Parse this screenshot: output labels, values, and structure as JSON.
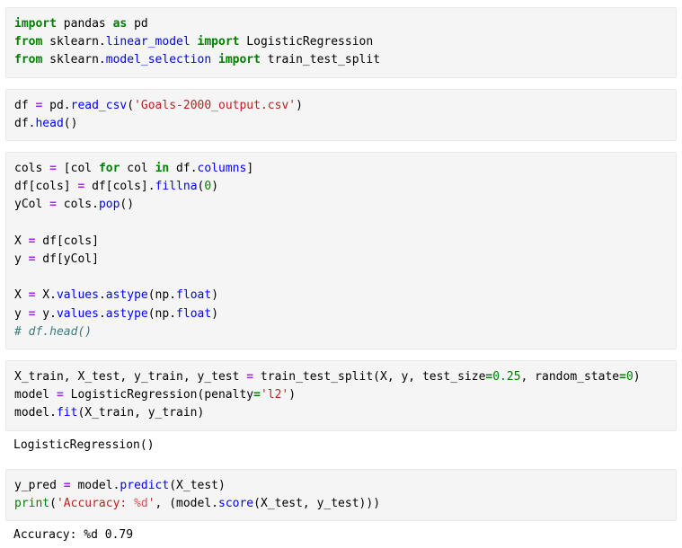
{
  "document": {
    "type": "jupyter-notebook-export",
    "colors": {
      "background": "#ffffff",
      "cell_background": "#f5f5f5",
      "cell_border": "#e8e8e8",
      "keyword": "#008000",
      "builtin": "#008000",
      "module": "#0000ff",
      "function": "#0000ff",
      "string": "#ba2121",
      "string_format": "#d85050",
      "operator": "#aa22ff",
      "number": "#008000",
      "comment": "#3d7b7b",
      "text": "#000000"
    }
  },
  "cells": [
    {
      "name": "imports-cell",
      "type": "code",
      "lines": [
        "import pandas as pd",
        "from sklearn.linear_model import LogisticRegression",
        "from sklearn.model_selection import train_test_split"
      ]
    },
    {
      "name": "load-data-cell",
      "type": "code",
      "lines": [
        "df = pd.read_csv('Goals-2000_output.csv')",
        "df.head()"
      ]
    },
    {
      "name": "prepare-features-cell",
      "type": "code",
      "lines": [
        "cols = [col for col in df.columns]",
        "df[cols] = df[cols].fillna(0)",
        "yCol = cols.pop()",
        "",
        "X = df[cols]",
        "y = df[yCol]",
        "",
        "X = X.values.astype(np.float)",
        "y = y.values.astype(np.float)",
        "# df.head()"
      ]
    },
    {
      "name": "train-model-cell",
      "type": "code",
      "lines": [
        "X_train, X_test, y_train, y_test = train_test_split(X, y, test_size=0.25, random_state=0)",
        "model = LogisticRegression(penalty='l2')",
        "model.fit(X_train, y_train)"
      ]
    },
    {
      "name": "model-output",
      "type": "output",
      "lines": [
        "LogisticRegression()"
      ]
    },
    {
      "name": "predict-score-cell",
      "type": "code",
      "lines": [
        "y_pred = model.predict(X_test)",
        "print('Accuracy: %d', (model.score(X_test, y_test)))"
      ]
    },
    {
      "name": "accuracy-output",
      "type": "output",
      "lines": [
        "Accuracy: %d 0.79"
      ]
    }
  ],
  "tokens": {
    "c1_l1": [
      [
        "import",
        "t-k"
      ],
      [
        " pandas ",
        "t-n"
      ],
      [
        "as",
        "t-k"
      ],
      [
        " pd",
        "t-n"
      ]
    ],
    "c1_l2": [
      [
        "from",
        "t-k"
      ],
      [
        " sklearn.",
        "t-n"
      ],
      [
        "linear_model",
        "t-nn"
      ],
      [
        " ",
        "t-n"
      ],
      [
        "import",
        "t-k"
      ],
      [
        " LogisticRegression",
        "t-n"
      ]
    ],
    "c1_l3": [
      [
        "from",
        "t-k"
      ],
      [
        " sklearn.",
        "t-n"
      ],
      [
        "model_selection",
        "t-nn"
      ],
      [
        " ",
        "t-n"
      ],
      [
        "import",
        "t-k"
      ],
      [
        " train_test_split",
        "t-n"
      ]
    ],
    "c2_l1": [
      [
        "df ",
        "t-n"
      ],
      [
        "=",
        "t-o"
      ],
      [
        " pd.",
        "t-n"
      ],
      [
        "read_csv",
        "t-nf"
      ],
      [
        "(",
        "t-n"
      ],
      [
        "'Goals-2000_output.csv'",
        "t-s"
      ],
      [
        ")",
        "t-n"
      ]
    ],
    "c2_l2": [
      [
        "df.",
        "t-n"
      ],
      [
        "head",
        "t-nf"
      ],
      [
        "()",
        "t-n"
      ]
    ],
    "c3_l1": [
      [
        "cols ",
        "t-n"
      ],
      [
        "=",
        "t-o"
      ],
      [
        " [col ",
        "t-n"
      ],
      [
        "for",
        "t-k"
      ],
      [
        " col ",
        "t-n"
      ],
      [
        "in",
        "t-k"
      ],
      [
        " df.",
        "t-n"
      ],
      [
        "columns",
        "t-nn"
      ],
      [
        "]",
        "t-n"
      ]
    ],
    "c3_l2": [
      [
        "df[cols] ",
        "t-n"
      ],
      [
        "=",
        "t-o"
      ],
      [
        " df[cols].",
        "t-n"
      ],
      [
        "fillna",
        "t-nf"
      ],
      [
        "(",
        "t-n"
      ],
      [
        "0",
        "t-m"
      ],
      [
        ")",
        "t-n"
      ]
    ],
    "c3_l3": [
      [
        "yCol ",
        "t-n"
      ],
      [
        "=",
        "t-o"
      ],
      [
        " cols.",
        "t-n"
      ],
      [
        "pop",
        "t-nf"
      ],
      [
        "()",
        "t-n"
      ]
    ],
    "c3_l5": [
      [
        "X ",
        "t-n"
      ],
      [
        "=",
        "t-o"
      ],
      [
        " df[cols]",
        "t-n"
      ]
    ],
    "c3_l6": [
      [
        "y ",
        "t-n"
      ],
      [
        "=",
        "t-o"
      ],
      [
        " df[yCol]",
        "t-n"
      ]
    ],
    "c3_l8": [
      [
        "X ",
        "t-n"
      ],
      [
        "=",
        "t-o"
      ],
      [
        " X.",
        "t-n"
      ],
      [
        "values",
        "t-nn"
      ],
      [
        ".",
        "t-n"
      ],
      [
        "astype",
        "t-nf"
      ],
      [
        "(np.",
        "t-n"
      ],
      [
        "float",
        "t-nn"
      ],
      [
        ")",
        "t-n"
      ]
    ],
    "c3_l9": [
      [
        "y ",
        "t-n"
      ],
      [
        "=",
        "t-o"
      ],
      [
        " y.",
        "t-n"
      ],
      [
        "values",
        "t-nn"
      ],
      [
        ".",
        "t-n"
      ],
      [
        "astype",
        "t-nf"
      ],
      [
        "(np.",
        "t-n"
      ],
      [
        "float",
        "t-nn"
      ],
      [
        ")",
        "t-n"
      ]
    ],
    "c3_l10": [
      [
        "# df.head()",
        "t-c"
      ]
    ],
    "c4_l1": [
      [
        "X_train, X_test, y_train, y_test ",
        "t-n"
      ],
      [
        "=",
        "t-o"
      ],
      [
        " train_test_split(X, y, test_size",
        "t-n"
      ],
      [
        "=",
        "t-ow"
      ],
      [
        "0.25",
        "t-m"
      ],
      [
        ", random_state",
        "t-n"
      ],
      [
        "=",
        "t-ow"
      ],
      [
        "0",
        "t-m"
      ],
      [
        ")",
        "t-n"
      ]
    ],
    "c4_l2": [
      [
        "model ",
        "t-n"
      ],
      [
        "=",
        "t-o"
      ],
      [
        " LogisticRegression(penalty",
        "t-n"
      ],
      [
        "=",
        "t-ow"
      ],
      [
        "'l2'",
        "t-s"
      ],
      [
        ")",
        "t-n"
      ]
    ],
    "c4_l3": [
      [
        "model.",
        "t-n"
      ],
      [
        "fit",
        "t-nf"
      ],
      [
        "(X_train, y_train)",
        "t-n"
      ]
    ],
    "c6_l1": [
      [
        "y_pred ",
        "t-n"
      ],
      [
        "=",
        "t-o"
      ],
      [
        " model.",
        "t-n"
      ],
      [
        "predict",
        "t-nf"
      ],
      [
        "(X_test)",
        "t-n"
      ]
    ],
    "c6_l2": [
      [
        "print",
        "t-nb"
      ],
      [
        "(",
        "t-n"
      ],
      [
        "'Accuracy: ",
        "t-s"
      ],
      [
        "%d",
        "t-si"
      ],
      [
        "'",
        "t-s"
      ],
      [
        ", (model.",
        "t-n"
      ],
      [
        "score",
        "t-nf"
      ],
      [
        "(X_test, y_test)))",
        "t-n"
      ]
    ]
  }
}
